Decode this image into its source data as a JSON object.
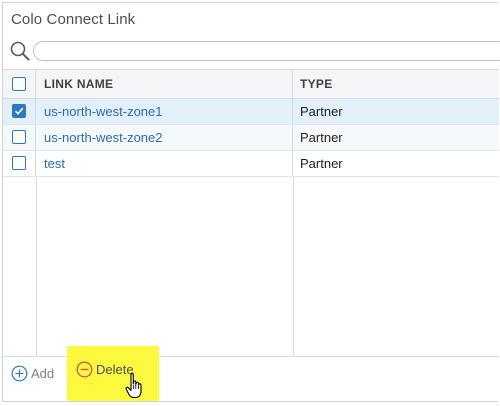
{
  "panel": {
    "title": "Colo Connect Link"
  },
  "search": {
    "placeholder": "",
    "value": ""
  },
  "table": {
    "columns": [
      "LINK NAME",
      "TYPE"
    ],
    "rows": [
      {
        "name": "us-north-west-zone1",
        "type": "Partner",
        "checked": true
      },
      {
        "name": "us-north-west-zone2",
        "type": "Partner",
        "checked": false
      },
      {
        "name": "test",
        "type": "Partner",
        "checked": false
      }
    ]
  },
  "footer": {
    "add_label": "Add",
    "delete_label": "Delete"
  },
  "colors": {
    "accent": "#2b7bc0",
    "delete": "#d9534f",
    "highlight": "#fcf93f"
  },
  "icons": [
    "search-icon",
    "add-icon",
    "delete-icon",
    "hand-cursor-icon"
  ]
}
